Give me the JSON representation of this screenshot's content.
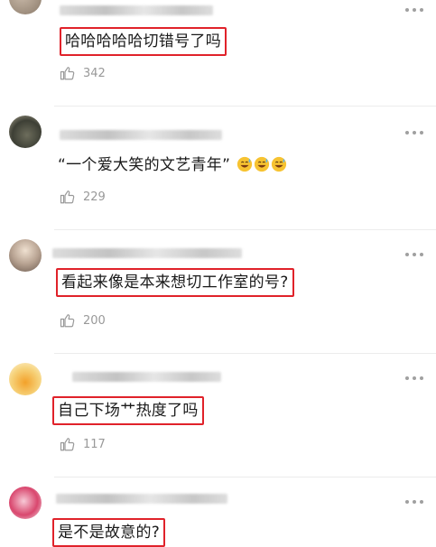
{
  "comments": [
    {
      "text": "哈哈哈哈哈切错号了吗",
      "likes": "342",
      "highlighted": true
    },
    {
      "text": "“一个爱大笑的文艺青年”",
      "emoji_count": 3,
      "emoji": "grinning-sweat-emoji",
      "likes": "229",
      "highlighted": false
    },
    {
      "text": "看起来像是本来想切工作室的号?",
      "likes": "200",
      "highlighted": true
    },
    {
      "text": "自己下场艹热度了吗",
      "likes": "117",
      "highlighted": true
    },
    {
      "text": "是不是故意的?",
      "highlighted": true
    }
  ],
  "icons": {
    "like": "thumbs-up-icon",
    "more": "more-dots-icon"
  },
  "colors": {
    "highlight_border": "#e0222a",
    "meta_text": "#999999",
    "divider": "#ececec"
  }
}
